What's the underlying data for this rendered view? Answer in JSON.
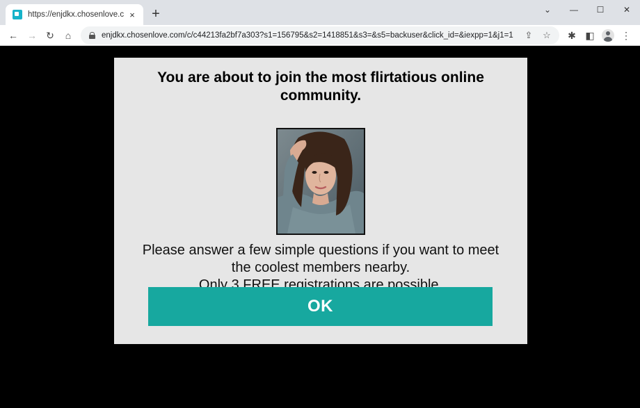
{
  "browser": {
    "tab": {
      "title": "https://enjdkx.chosenlove.com/c",
      "close": "×"
    },
    "new_tab": "+",
    "window_controls": {
      "dropdown": "⌄",
      "minimize": "—",
      "maximize": "☐",
      "close": "✕"
    },
    "nav": {
      "back": "←",
      "forward": "→",
      "reload": "↻",
      "home": "⌂"
    },
    "url": "enjdkx.chosenlove.com/c/c44213fa2bf7a303?s1=156795&s2=1418851&s3=&s5=backuser&click_id=&iexpp=1&j1=1",
    "omnibox_icons": {
      "share": "⇪",
      "bookmark": "☆"
    },
    "toolbar_icons": {
      "extensions": "✱",
      "side_panel": "◧",
      "menu": "⋮"
    }
  },
  "modal": {
    "heading": "You are about to join the most flirtatious online community.",
    "body_lines": [
      "Please answer a few simple questions if you want to meet the coolest members nearby.",
      "Only 3 FREE registrations are possible."
    ],
    "button_label": "OK"
  },
  "colors": {
    "accent": "#17a89f",
    "modal_bg": "#e6e6e6",
    "page_bg": "#000000",
    "titlebar_bg": "#dee1e6"
  }
}
